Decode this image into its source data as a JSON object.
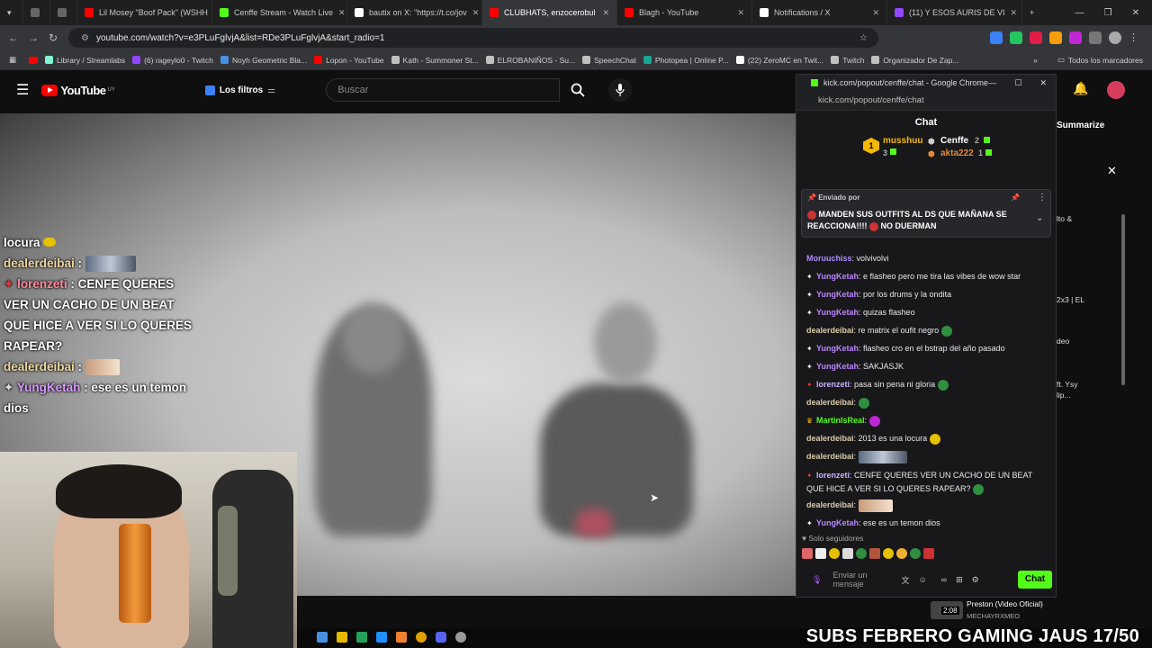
{
  "browser": {
    "tabs": [
      {
        "label": "Lil Mosey \"Boof Pack\" (WSHH",
        "color": "#ff0000"
      },
      {
        "label": "Cenffe Stream - Watch Live",
        "color": "#53fc18"
      },
      {
        "label": "bautix on X: \"https://t.co/jov",
        "color": "#ffffff"
      },
      {
        "label": "CLUBHATS, enzocerobul",
        "color": "#ff0000",
        "active": true
      },
      {
        "label": "Blagh - YouTube",
        "color": "#ff0000"
      },
      {
        "label": "Notifications / X",
        "color": "#ffffff"
      },
      {
        "label": "(11) Y ESOS AURIS DE VI",
        "color": "#9146ff"
      }
    ],
    "url": "youtube.com/watch?v=e3PLuFglvjA&list=RDe3PLuFglvjA&start_radio=1",
    "bookmarks": [
      {
        "label": "Library / Streamlabs",
        "color": "#80f5d2"
      },
      {
        "label": "(6) rageylo0 - Twitch",
        "color": "#9146ff"
      },
      {
        "label": "Noyh Geometric Bla...",
        "color": "#4a90e2"
      },
      {
        "label": "Lopon - YouTube",
        "color": "#ff0000"
      },
      {
        "label": "Kạth - Summoner St...",
        "color": "#c0c0c0"
      },
      {
        "label": "ELROBANIÑOS - Su...",
        "color": "#c0c0c0"
      },
      {
        "label": "SpeechChat",
        "color": "#c0c0c0"
      },
      {
        "label": "Photopea | Online P...",
        "color": "#18a497"
      },
      {
        "label": "(22) ZeroMC en Twit...",
        "color": "#ffffff"
      },
      {
        "label": "Twitch",
        "color": "#c0c0c0"
      },
      {
        "label": "Organizador De Zap...",
        "color": "#c0c0c0"
      }
    ],
    "all_bookmarks": "Todos los marcadores"
  },
  "youtube": {
    "logo": "YouTube",
    "country": "UY",
    "filters": "Los filtros",
    "search_placeholder": "Buscar",
    "summarize": "Summarize",
    "side_snippets": [
      "lto &",
      "2x3 | EL",
      "deo",
      "ft. Ysy",
      "lip..."
    ],
    "bottom_title": "Preston (Video Oficial)",
    "bottom_channel": "MECHAYRXMEO",
    "bottom_duration": "2:08"
  },
  "overlay_chat": [
    {
      "user": "",
      "text": "locura"
    },
    {
      "user": "dealerdeibai",
      "text": ""
    },
    {
      "user": "lorenzeti",
      "text": "CENFE QUERES VER UN CACHO DE UN BEAT QUE HICE A VER SI LO QUERES RAPEAR?"
    },
    {
      "user": "dealerdeibai",
      "text": ""
    },
    {
      "user": "YungKetah",
      "text": "ese es un temon dios"
    }
  ],
  "kick": {
    "window_title": "kick.com/popout/cenffe/chat - Google Chrome",
    "url": "kick.com/popout/cenffe/chat",
    "header": "Chat",
    "leaderboard": [
      {
        "rank": "1",
        "name": "musshuu",
        "count": "3"
      },
      {
        "name": "Cenffe",
        "count": "2"
      },
      {
        "name": "akta222",
        "count": "1"
      }
    ],
    "pinned_by": "Enviado por",
    "pinned_text": "MANDEN SUS OUTFITS AL DS QUE MAÑANA SE REACCIONA!!!!",
    "pinned_text2": "NO DUERMAN",
    "messages": [
      {
        "user": "Moruuchiss",
        "text": "volvivolvi"
      },
      {
        "user": "YungKetah",
        "text": "e flasheo pero me tira las vibes de wow star"
      },
      {
        "user": "YungKetah",
        "text": "por los drums y la ondita"
      },
      {
        "user": "YungKetah",
        "text": "quizas flasheo"
      },
      {
        "user": "dealerdeibai",
        "text": "re matrix el oufit negro"
      },
      {
        "user": "YungKetah",
        "text": "flasheo cro en el bstrap del año pasado"
      },
      {
        "user": "YungKetah",
        "text": "SAKJASJK"
      },
      {
        "user": "lorenzeti",
        "text": "pasa sin pena ni gloria"
      },
      {
        "user": "dealerdeibai",
        "text": ""
      },
      {
        "user": "MartinIsReal",
        "text": ""
      },
      {
        "user": "dealerdeibai",
        "text": "2013 es una locura"
      },
      {
        "user": "dealerdeibai",
        "text": ""
      },
      {
        "user": "lorenzeti",
        "text": "CENFE QUERES VER UN CACHO DE UN BEAT"
      },
      {
        "user": "",
        "text": "QUE HICE A VER SI LO QUERES RAPEAR?"
      },
      {
        "user": "dealerdeibai",
        "text": ""
      },
      {
        "user": "YungKetah",
        "text": "ese es un temon dios"
      }
    ],
    "followers_only": "Solo seguidores",
    "input_placeholder": "Enviar un mensaje",
    "send_label": "Chat"
  },
  "ticker": "SUBS FEBRERO GAMING JAUS 17/50"
}
